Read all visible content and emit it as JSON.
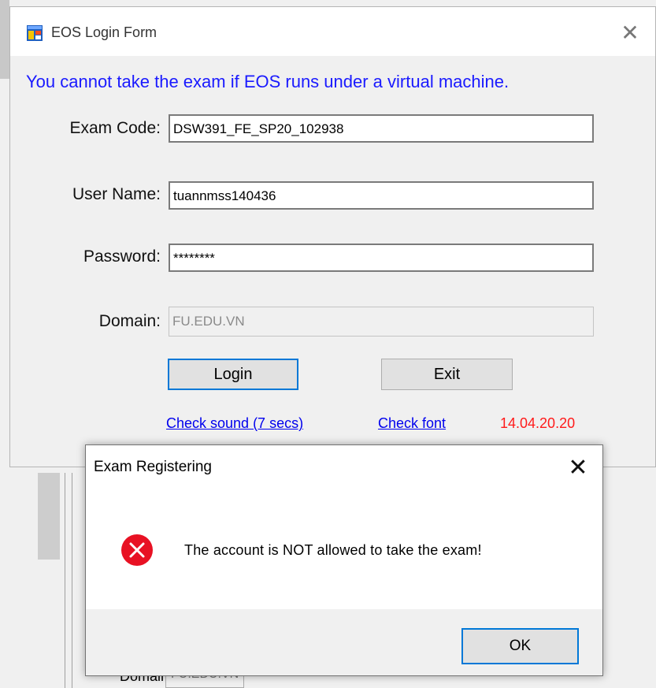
{
  "login_window": {
    "title": "EOS Login Form",
    "warning": "You cannot take the exam if EOS runs under a virtual machine.",
    "exam_code": {
      "label": "Exam Code:",
      "value": "DSW391_FE_SP20_102938"
    },
    "user_name": {
      "label": "User Name:",
      "value": "tuannmss140436"
    },
    "password": {
      "label": "Password:",
      "value": "********"
    },
    "domain": {
      "label": "Domain:",
      "value": "FU.EDU.VN"
    },
    "login_label": "Login",
    "exit_label": "Exit",
    "check_sound": "Check sound (7 secs)",
    "check_font": "Check font",
    "version": "14.04.20.20"
  },
  "dialog": {
    "title": "Exam Registering",
    "message": "The account is NOT allowed to take the exam!",
    "ok_label": "OK"
  },
  "background": {
    "domain_label": "Domain:",
    "domain_value": "FU.EDU.VN"
  },
  "icons": {
    "app": "eos-app-icon",
    "error": "error-icon",
    "close": "close-icon"
  },
  "colors": {
    "warning_text": "#1a1aff",
    "link": "#0000ee",
    "version": "#ff1a1a",
    "error_red": "#e81123",
    "focus_blue": "#0078d7"
  }
}
